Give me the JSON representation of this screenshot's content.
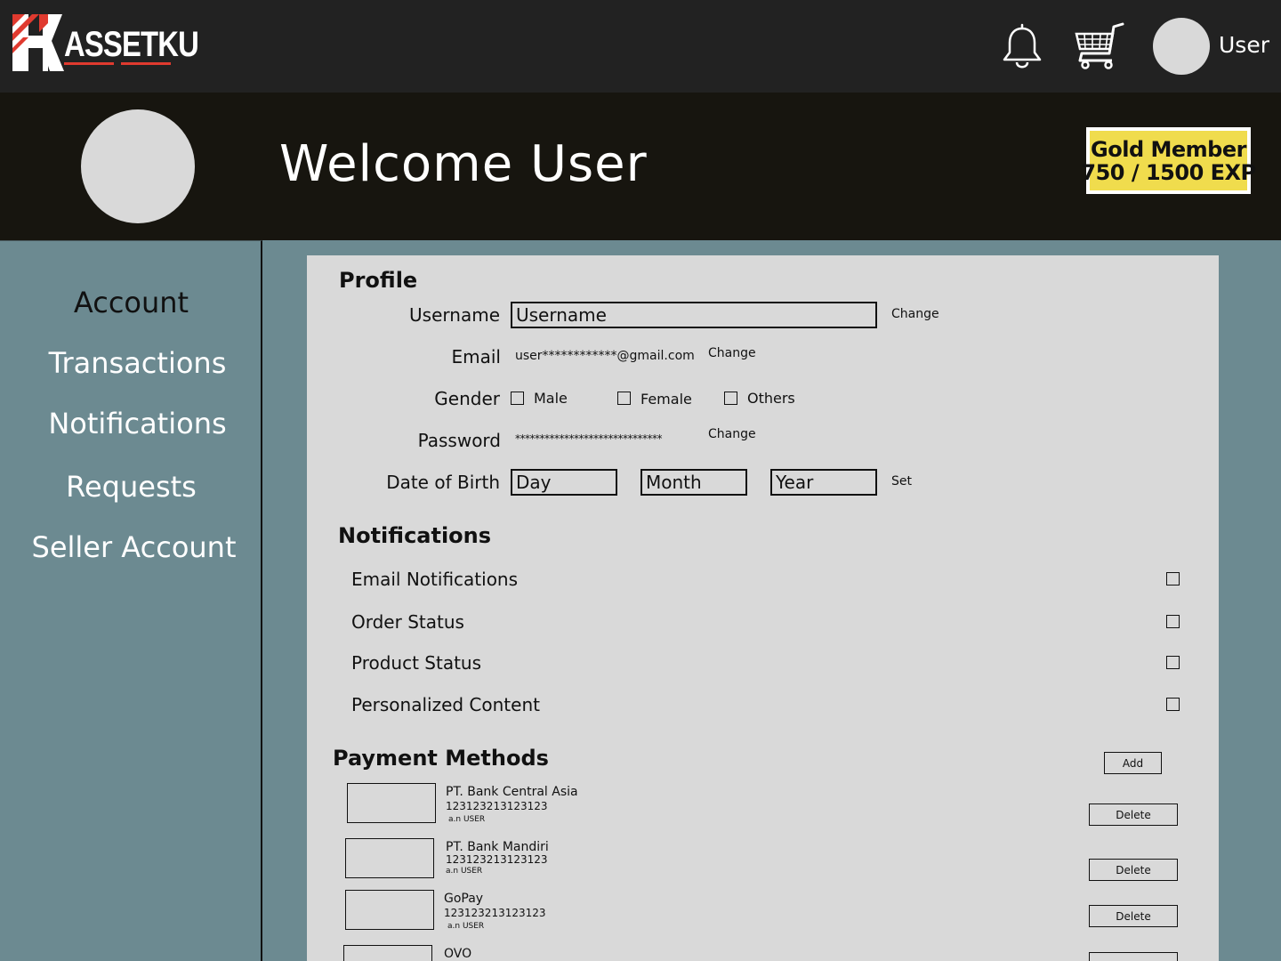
{
  "header": {
    "logo_text": "ASSETKU",
    "user_label": "User"
  },
  "banner": {
    "welcome": "Welcome User",
    "member_tier": "Gold Member",
    "member_exp": "750 / 1500 EXP"
  },
  "sidebar": {
    "items": [
      {
        "label": "Account"
      },
      {
        "label": "Transactions"
      },
      {
        "label": "Notifications"
      },
      {
        "label": "Requests"
      },
      {
        "label": "Seller Account"
      }
    ]
  },
  "profile": {
    "title": "Profile",
    "username_label": "Username",
    "username_placeholder": "Username",
    "username_change": "Change",
    "email_label": "Email",
    "email_value": "user************@gmail.com",
    "email_change": "Change",
    "gender_label": "Gender",
    "gender_options": [
      {
        "label": "Male"
      },
      {
        "label": "Female"
      },
      {
        "label": "Others"
      }
    ],
    "password_label": "Password",
    "password_value": "******************************",
    "password_change": "Change",
    "dob_label": "Date of Birth",
    "dob_day_placeholder": "Day",
    "dob_month_placeholder": "Month",
    "dob_year_placeholder": "Year",
    "dob_set": "Set"
  },
  "notifications": {
    "title": "Notifications",
    "items": [
      {
        "label": "Email Notifications"
      },
      {
        "label": "Order Status"
      },
      {
        "label": "Product Status"
      },
      {
        "label": "Personalized Content"
      }
    ]
  },
  "payment": {
    "title": "Payment Methods",
    "add_label": "Add",
    "delete_label": "Delete",
    "methods": [
      {
        "name": "PT. Bank Central Asia",
        "number": "123123213123123",
        "holder": "a.n USER"
      },
      {
        "name": "PT. Bank Mandiri",
        "number": "123123213123123",
        "holder": "a.n USER"
      },
      {
        "name": "GoPay",
        "number": "123123213123123",
        "holder": "a.n USER"
      },
      {
        "name": "OVO"
      }
    ]
  },
  "colors": {
    "topbar": "#222222",
    "banner": "#17150f",
    "sidebar": "#6c8a91",
    "panel": "#d9d9d9",
    "badge": "#f0dc4d",
    "logo_accent": "#e03a2f"
  }
}
